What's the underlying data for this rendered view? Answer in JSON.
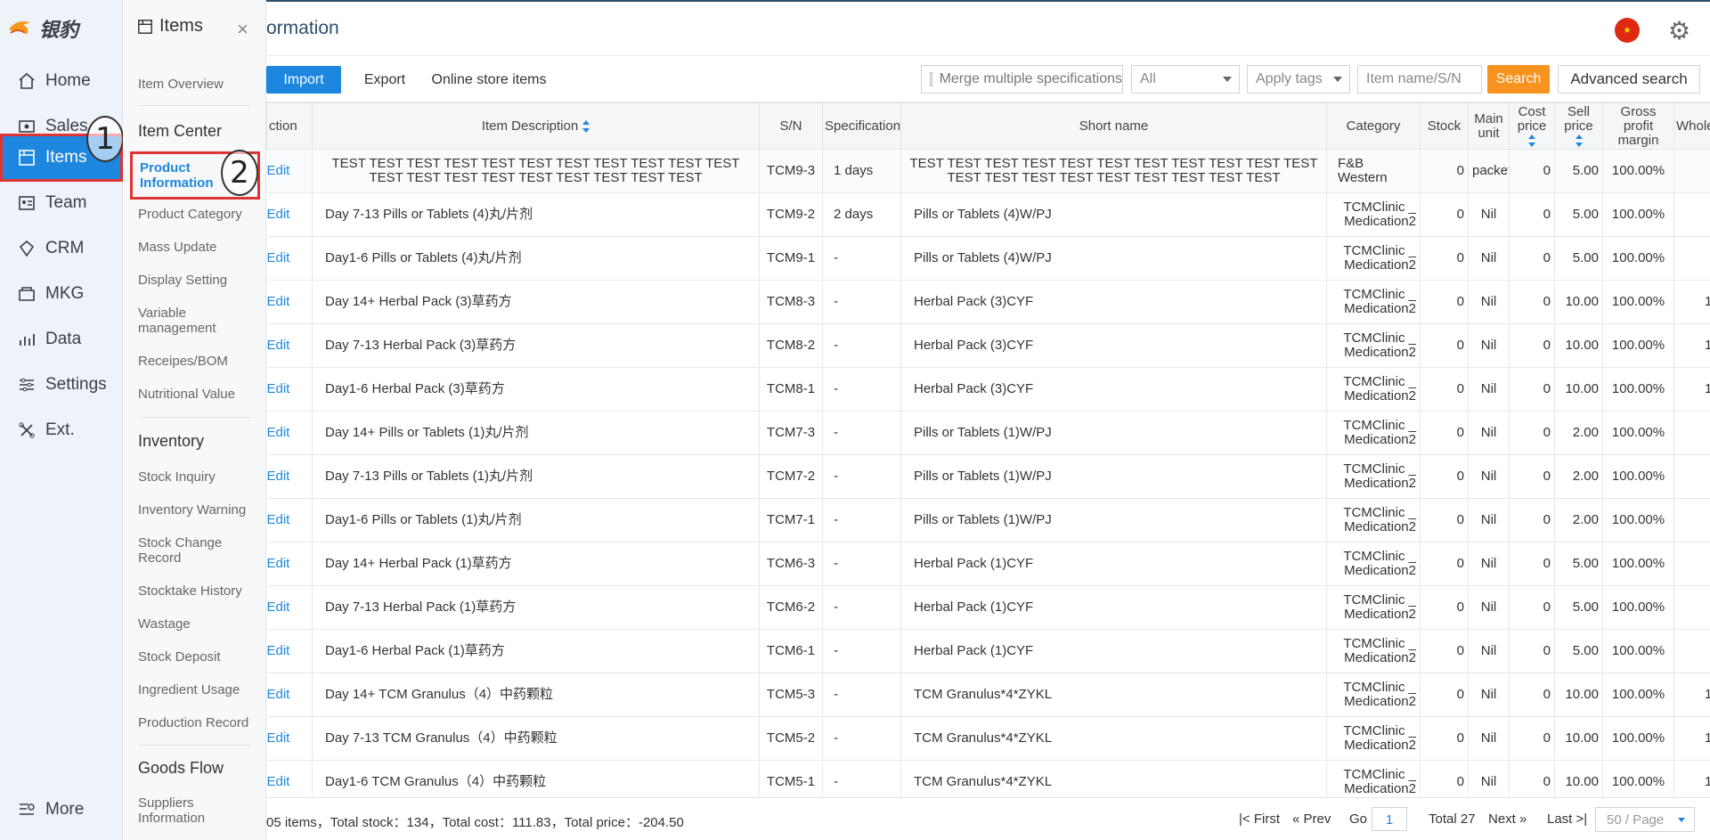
{
  "logo": {
    "text": "银豹"
  },
  "nav": [
    {
      "label": "Home",
      "icon": "home-icon"
    },
    {
      "label": "Sales",
      "icon": "sales-icon"
    },
    {
      "label": "Items",
      "icon": "items-icon"
    },
    {
      "label": "Team",
      "icon": "team-icon"
    },
    {
      "label": "CRM",
      "icon": "crm-icon"
    },
    {
      "label": "MKG",
      "icon": "mkg-icon"
    },
    {
      "label": "Data",
      "icon": "data-icon"
    },
    {
      "label": "Settings",
      "icon": "settings-icon"
    },
    {
      "label": "Ext.",
      "icon": "ext-icon"
    },
    {
      "label": "More",
      "icon": "more-icon"
    }
  ],
  "annotations": {
    "one": "1",
    "two": "2"
  },
  "submenu": {
    "title": "Items",
    "close": "×",
    "overview": "Item Overview",
    "item_center": {
      "heading": "Item Center",
      "items": [
        "Product Information",
        "Product Category",
        "Mass Update",
        "Display Setting",
        "Variable management",
        "Receipes/BOM",
        "Nutritional Value"
      ]
    },
    "inventory": {
      "heading": "Inventory",
      "items": [
        "Stock Inquiry",
        "Inventory Warning",
        "Stock Change Record",
        "Stocktake History",
        "Wastage",
        "Stock Deposit",
        "Ingredient Usage",
        "Production Record"
      ]
    },
    "goods_flow": {
      "heading": "Goods Flow",
      "items": [
        "Suppliers Information"
      ]
    }
  },
  "header": {
    "title_partial": "ormation"
  },
  "toolbar": {
    "import": "Import",
    "export": "Export",
    "online": "Online store items",
    "merge": "Merge multiple specifications",
    "all_select": "All",
    "apply_tags": "Apply tags",
    "search_placeholder": "Item name/S/N",
    "search": "Search",
    "advanced": "Advanced search"
  },
  "table": {
    "headers": {
      "action": "ction",
      "desc": "Item Description",
      "sn": "S/N",
      "spec": "Specification",
      "short": "Short name",
      "category": "Category",
      "stock": "Stock",
      "unit": "Main unit",
      "cost": "Cost price",
      "sell": "Sell price",
      "margin": "Gross profit margin",
      "whole": "Whole price"
    },
    "edit_label": "Edit",
    "rows": [
      {
        "desc": "TEST TEST TEST TEST TEST TEST TEST TEST TEST TEST TEST TEST TEST TEST TEST TEST TEST TEST TEST TEST",
        "sn": "TCM9-3",
        "spec": "1 days",
        "short": "TEST TEST TEST TEST TEST TEST TEST TEST TEST TEST TEST TEST TEST TEST TEST TEST TEST TEST TEST TEST",
        "cat1": "F&B",
        "cat2": "Western",
        "stock": "0",
        "unit": "packet",
        "cost": "0",
        "sell": "5.00",
        "margin": "100.00%",
        "whole": ""
      },
      {
        "desc": "Day 7-13 Pills or Tablets (4)丸/片剂",
        "sn": "TCM9-2",
        "spec": "2 days",
        "short": "Pills or Tablets (4)W/PJ",
        "cat1": "TCMClinic _",
        "cat2": "Medication2",
        "stock": "0",
        "unit": "Nil",
        "cost": "0",
        "sell": "5.00",
        "margin": "100.00%",
        "whole": ""
      },
      {
        "desc": "Day1-6 Pills or Tablets (4)丸/片剂",
        "sn": "TCM9-1",
        "spec": "-",
        "short": "Pills or Tablets (4)W/PJ",
        "cat1": "TCMClinic _",
        "cat2": "Medication2",
        "stock": "0",
        "unit": "Nil",
        "cost": "0",
        "sell": "5.00",
        "margin": "100.00%",
        "whole": ""
      },
      {
        "desc": "Day 14+ Herbal Pack (3)草药方",
        "sn": "TCM8-3",
        "spec": "-",
        "short": "Herbal Pack (3)CYF",
        "cat1": "TCMClinic _",
        "cat2": "Medication2",
        "stock": "0",
        "unit": "Nil",
        "cost": "0",
        "sell": "10.00",
        "margin": "100.00%",
        "whole": "1"
      },
      {
        "desc": "Day 7-13 Herbal Pack (3)草药方",
        "sn": "TCM8-2",
        "spec": "-",
        "short": "Herbal Pack (3)CYF",
        "cat1": "TCMClinic _",
        "cat2": "Medication2",
        "stock": "0",
        "unit": "Nil",
        "cost": "0",
        "sell": "10.00",
        "margin": "100.00%",
        "whole": "1"
      },
      {
        "desc": "Day1-6 Herbal Pack (3)草药方",
        "sn": "TCM8-1",
        "spec": "-",
        "short": "Herbal Pack (3)CYF",
        "cat1": "TCMClinic _",
        "cat2": "Medication2",
        "stock": "0",
        "unit": "Nil",
        "cost": "0",
        "sell": "10.00",
        "margin": "100.00%",
        "whole": "1"
      },
      {
        "desc": "Day 14+ Pills or Tablets (1)丸/片剂",
        "sn": "TCM7-3",
        "spec": "-",
        "short": "Pills or Tablets (1)W/PJ",
        "cat1": "TCMClinic _",
        "cat2": "Medication2",
        "stock": "0",
        "unit": "Nil",
        "cost": "0",
        "sell": "2.00",
        "margin": "100.00%",
        "whole": ""
      },
      {
        "desc": "Day 7-13 Pills or Tablets (1)丸/片剂",
        "sn": "TCM7-2",
        "spec": "-",
        "short": "Pills or Tablets (1)W/PJ",
        "cat1": "TCMClinic _",
        "cat2": "Medication2",
        "stock": "0",
        "unit": "Nil",
        "cost": "0",
        "sell": "2.00",
        "margin": "100.00%",
        "whole": ""
      },
      {
        "desc": "Day1-6 Pills or Tablets (1)丸/片剂",
        "sn": "TCM7-1",
        "spec": "-",
        "short": "Pills or Tablets (1)W/PJ",
        "cat1": "TCMClinic _",
        "cat2": "Medication2",
        "stock": "0",
        "unit": "Nil",
        "cost": "0",
        "sell": "2.00",
        "margin": "100.00%",
        "whole": ""
      },
      {
        "desc": "Day 14+ Herbal Pack (1)草药方",
        "sn": "TCM6-3",
        "spec": "-",
        "short": "Herbal Pack (1)CYF",
        "cat1": "TCMClinic _",
        "cat2": "Medication2",
        "stock": "0",
        "unit": "Nil",
        "cost": "0",
        "sell": "5.00",
        "margin": "100.00%",
        "whole": ""
      },
      {
        "desc": "Day 7-13 Herbal Pack (1)草药方",
        "sn": "TCM6-2",
        "spec": "-",
        "short": "Herbal Pack (1)CYF",
        "cat1": "TCMClinic _",
        "cat2": "Medication2",
        "stock": "0",
        "unit": "Nil",
        "cost": "0",
        "sell": "5.00",
        "margin": "100.00%",
        "whole": ""
      },
      {
        "desc": "Day1-6 Herbal Pack (1)草药方",
        "sn": "TCM6-1",
        "spec": "-",
        "short": "Herbal Pack (1)CYF",
        "cat1": "TCMClinic _",
        "cat2": "Medication2",
        "stock": "0",
        "unit": "Nil",
        "cost": "0",
        "sell": "5.00",
        "margin": "100.00%",
        "whole": ""
      },
      {
        "desc": "Day 14+ TCM Granulus（4）中药颗粒",
        "sn": "TCM5-3",
        "spec": "-",
        "short": "TCM Granulus*4*ZYKL",
        "cat1": "TCMClinic _",
        "cat2": "Medication2",
        "stock": "0",
        "unit": "Nil",
        "cost": "0",
        "sell": "10.00",
        "margin": "100.00%",
        "whole": "1"
      },
      {
        "desc": "Day 7-13 TCM Granulus（4）中药颗粒",
        "sn": "TCM5-2",
        "spec": "-",
        "short": "TCM Granulus*4*ZYKL",
        "cat1": "TCMClinic _",
        "cat2": "Medication2",
        "stock": "0",
        "unit": "Nil",
        "cost": "0",
        "sell": "10.00",
        "margin": "100.00%",
        "whole": "1"
      },
      {
        "desc": "Day1-6 TCM Granulus（4）中药颗粒",
        "sn": "TCM5-1",
        "spec": "-",
        "short": "TCM Granulus*4*ZYKL",
        "cat1": "TCMClinic _",
        "cat2": "Medication2",
        "stock": "0",
        "unit": "Nil",
        "cost": "0",
        "sell": "10.00",
        "margin": "100.00%",
        "whole": "1"
      }
    ]
  },
  "footer": {
    "summary": "05 items，Total stock：134，Total cost：111.83，Total price：-204.50",
    "first": "First",
    "prev": "Prev",
    "go": "Go",
    "page": "1",
    "total": "Total 27",
    "next": "Next",
    "last": "Last",
    "page_size": "50 / Page"
  },
  "colors": {
    "accent": "#1d86de",
    "search": "#f7931e",
    "highlight": "#e03333",
    "flag": "#de2910"
  }
}
